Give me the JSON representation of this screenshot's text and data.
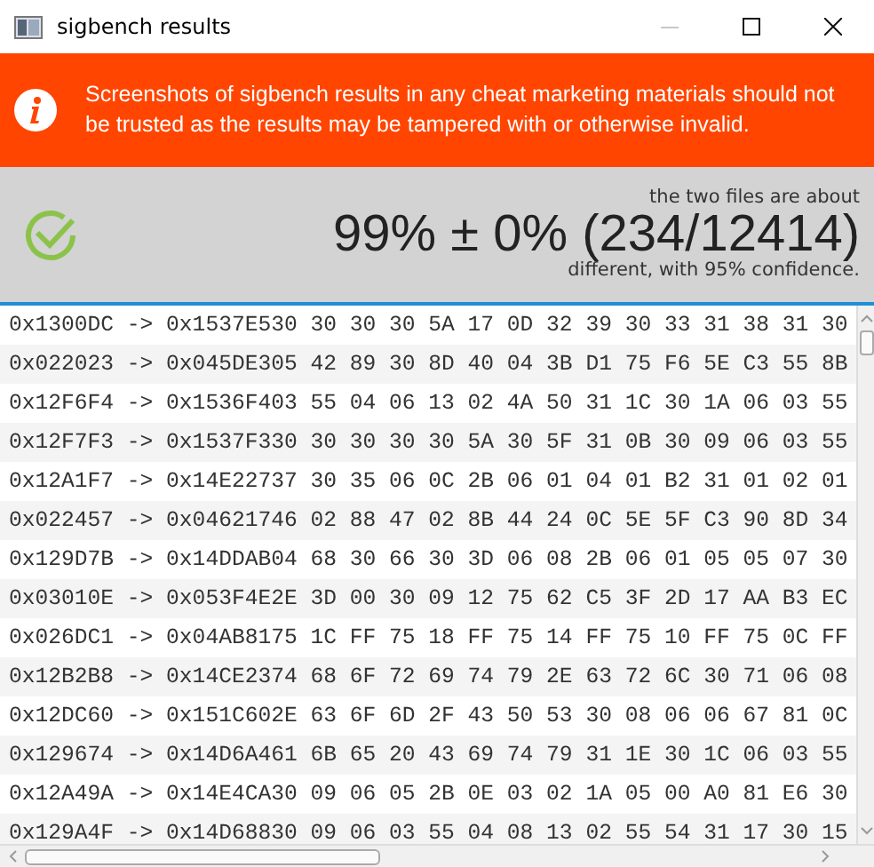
{
  "window": {
    "title": "sigbench results",
    "controls": [
      {
        "kind": "minimize",
        "disabled": true
      },
      {
        "kind": "maximize",
        "disabled": false
      },
      {
        "kind": "close",
        "disabled": false
      }
    ]
  },
  "banner": {
    "text": "Screenshots of sigbench results in any cheat marketing materials should not be trusted as the results may be tampered with or otherwise invalid."
  },
  "result": {
    "caption_above": "the two files are about",
    "headline": "99% ± 0% (234/12414)",
    "caption_below": "different, with 95% confidence."
  },
  "rows": [
    "0x1300DC -> 0x1537E530 30 30 30 5A 17 0D 32 39 30 33 31 38 31 30",
    "0x022023 -> 0x045DE305 42 89 30 8D 40 04 3B D1 75 F6 5E C3 55 8B",
    "0x12F6F4 -> 0x1536F403 55 04 06 13 02 4A 50 31 1C 30 1A 06 03 55",
    "0x12F7F3 -> 0x1537F330 30 30 30 30 5A 30 5F 31 0B 30 09 06 03 55",
    "0x12A1F7 -> 0x14E22737 30 35 06 0C 2B 06 01 04 01 B2 31 01 02 01",
    "0x022457 -> 0x04621746 02 88 47 02 8B 44 24 0C 5E 5F C3 90 8D 34",
    "0x129D7B -> 0x14DDAB04 68 30 66 30 3D 06 08 2B 06 01 05 05 07 30",
    "0x03010E -> 0x053F4E2E 3D 00 30 09 12 75 62 C5 3F 2D 17 AA B3 EC",
    "0x026DC1 -> 0x04AB8175 1C FF 75 18 FF 75 14 FF 75 10 FF 75 0C FF",
    "0x12B2B8 -> 0x14CE2374 68 6F 72 69 74 79 2E 63 72 6C 30 71 06 08",
    "0x12DC60 -> 0x151C602E 63 6F 6D 2F 43 50 53 30 08 06 06 67 81 0C",
    "0x129674 -> 0x14D6A461 6B 65 20 43 69 74 79 31 1E 30 1C 06 03 55",
    "0x12A49A -> 0x14E4CA30 09 06 05 2B 0E 03 02 1A 05 00 A0 81 E6 30",
    "0x129A4F -> 0x14D68830 09 06 03 55 04 08 13 02 55 54 31 17 30 15"
  ]
}
